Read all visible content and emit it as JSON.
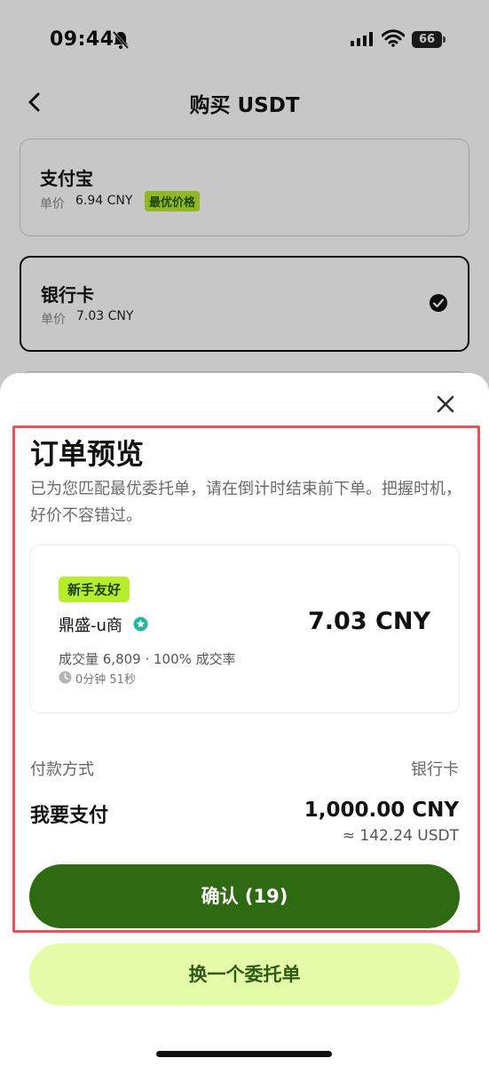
{
  "status_bar": {
    "time": "09:44",
    "battery": "66"
  },
  "nav": {
    "title": "购买 USDT"
  },
  "payment_options": [
    {
      "name": "支付宝",
      "price_label": "单价",
      "price": "6.94 CNY",
      "badge": "最优价格"
    },
    {
      "name": "银行卡",
      "price_label": "单价",
      "price": "7.03 CNY",
      "selected": true
    }
  ],
  "sheet": {
    "title": "订单预览",
    "description": "已为您匹配最优委托单，请在倒计时结束前下单。把握时机，好价不容错过。",
    "offer": {
      "badge": "新手友好",
      "merchant": "鼎盛-u商",
      "price": "7.03 CNY",
      "stats": "成交量 6,809 · 100% 成交率",
      "timer": "0分钟 51秒"
    },
    "payment_method_label": "付款方式",
    "payment_method_value": "银行卡",
    "pay_label": "我要支付",
    "pay_amount": "1,000.00 CNY",
    "pay_usdt": "≈ 142.24 USDT",
    "confirm_label": "确认 (19)",
    "switch_label": "换一个委托单"
  },
  "colors": {
    "primary": "#2d6a12",
    "accent_lime": "#b6ee2f",
    "secondary_button": "#e4fba8",
    "highlight": "#e8525a"
  },
  "icons": [
    "bell-muted-icon",
    "signal-icon",
    "wifi-icon",
    "battery-icon",
    "back-icon",
    "check-icon",
    "close-icon",
    "verified-icon",
    "clock-icon"
  ]
}
